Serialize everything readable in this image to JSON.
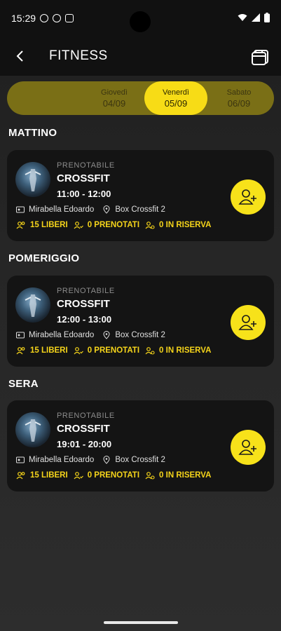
{
  "status_bar": {
    "time": "15:29"
  },
  "header": {
    "title": "FITNESS"
  },
  "days": [
    {
      "name": "Giovedì",
      "date": "04/09",
      "active": false
    },
    {
      "name": "Venerdì",
      "date": "05/09",
      "active": true
    },
    {
      "name": "Sabato",
      "date": "06/09",
      "active": false
    }
  ],
  "sections": [
    {
      "title": "MATTINO",
      "card": {
        "status": "PRENOTABILE",
        "name": "CROSSFIT",
        "time": "11:00 - 12:00",
        "instructor": "Mirabella Edoardo",
        "location": "Box Crossfit 2",
        "free": "15 LIBERI",
        "booked": "0 PRENOTATI",
        "reserve": "0 IN RISERVA"
      }
    },
    {
      "title": "POMERIGGIO",
      "card": {
        "status": "PRENOTABILE",
        "name": "CROSSFIT",
        "time": "12:00 - 13:00",
        "instructor": "Mirabella Edoardo",
        "location": "Box Crossfit 2",
        "free": "15 LIBERI",
        "booked": "0 PRENOTATI",
        "reserve": "0 IN RISERVA"
      }
    },
    {
      "title": "SERA",
      "card": {
        "status": "PRENOTABILE",
        "name": "CROSSFIT",
        "time": "19:01 - 20:00",
        "instructor": "Mirabella Edoardo",
        "location": "Box Crossfit 2",
        "free": "15 LIBERI",
        "booked": "0 PRENOTATI",
        "reserve": "0 IN RISERVA"
      }
    }
  ],
  "colors": {
    "accent": "#f7dc16",
    "day_bar": "#7a6f16",
    "card_bg": "#141414"
  },
  "icons": {
    "back": "arrow-left-icon",
    "calendar": "calendar-icon",
    "instructor": "id-card-icon",
    "location": "map-pin-icon",
    "people": "people-icon",
    "book": "add-user-icon"
  }
}
